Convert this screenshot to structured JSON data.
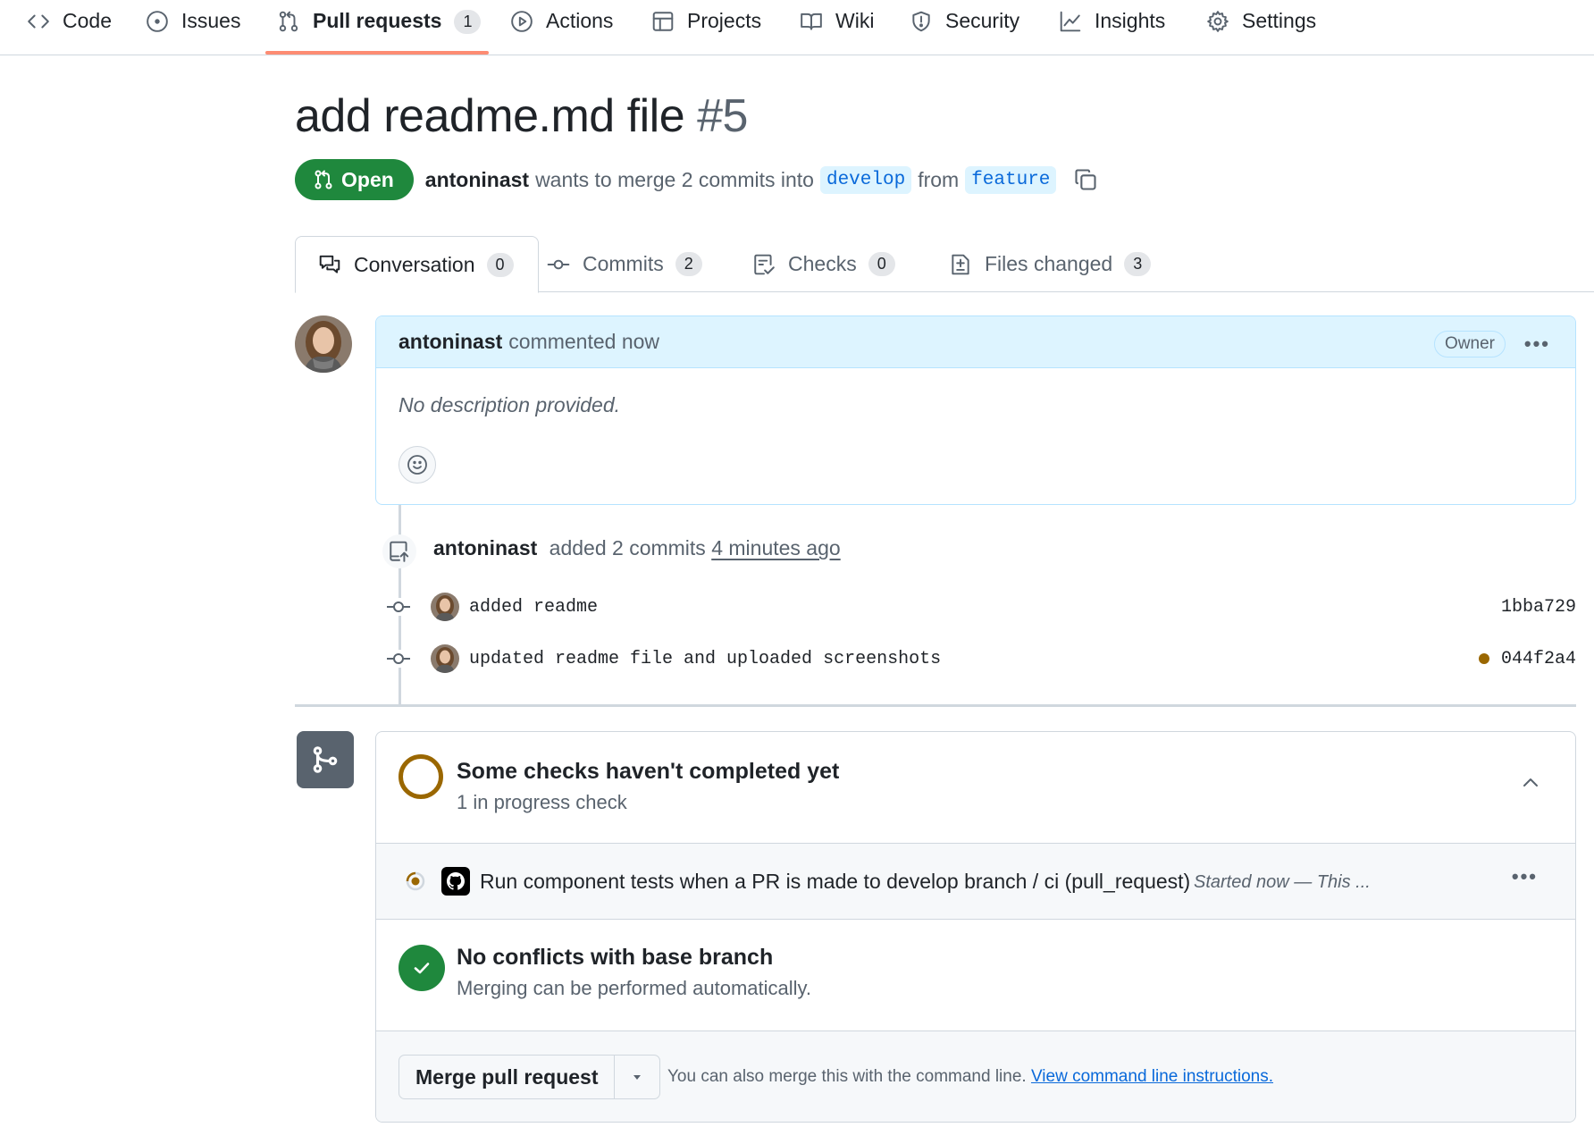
{
  "repo_nav": {
    "items": [
      {
        "label": "Code",
        "icon": "code-icon"
      },
      {
        "label": "Issues",
        "icon": "issue-icon"
      },
      {
        "label": "Pull requests",
        "icon": "pull-request-icon",
        "count": "1",
        "active": true
      },
      {
        "label": "Actions",
        "icon": "play-icon"
      },
      {
        "label": "Projects",
        "icon": "table-icon"
      },
      {
        "label": "Wiki",
        "icon": "book-icon"
      },
      {
        "label": "Security",
        "icon": "shield-icon"
      },
      {
        "label": "Insights",
        "icon": "graph-icon"
      },
      {
        "label": "Settings",
        "icon": "gear-icon"
      }
    ]
  },
  "pr": {
    "title": "add readme.md file",
    "number": "#5",
    "state": "Open",
    "author": "antoninast",
    "merge_text_1": "wants to merge 2 commits into",
    "base_branch": "develop",
    "merge_text_2": "from",
    "head_branch": "feature"
  },
  "tabs": [
    {
      "label": "Conversation",
      "count": "0",
      "icon": "comment-discussion-icon"
    },
    {
      "label": "Commits",
      "count": "2",
      "icon": "commit-icon"
    },
    {
      "label": "Checks",
      "count": "0",
      "icon": "checklist-icon"
    },
    {
      "label": "Files changed",
      "count": "3",
      "icon": "file-diff-icon"
    }
  ],
  "comment": {
    "author": "antoninast",
    "action": "commented now",
    "role_badge": "Owner",
    "body": "No description provided."
  },
  "commit_event": {
    "author": "antoninast",
    "action": "added 2 commits",
    "time": "4 minutes ago",
    "commits": [
      {
        "message": "added readme",
        "sha": "1bba729",
        "pending": false
      },
      {
        "message": "updated readme file and uploaded screenshots",
        "sha": "044f2a4",
        "pending": true
      }
    ]
  },
  "merge_box": {
    "checks_heading": "Some checks haven't completed yet",
    "checks_sub": "1 in progress check",
    "check_name": "Run component tests when a PR is made to develop branch / ci (pull_request)",
    "check_status": "Started now — This ...",
    "conflicts_heading": "No conflicts with base branch",
    "conflicts_sub": "Merging can be performed automatically.",
    "merge_button": "Merge pull request",
    "cli_text": "You can also merge this with the command line.",
    "cli_link": "View command line instructions."
  },
  "colors": {
    "open_green": "#1f883d",
    "pending_yellow": "#9a6700",
    "link_blue": "#0969da",
    "comment_header_bg": "#ddf4ff",
    "active_tab_underline": "#fd8c73"
  }
}
